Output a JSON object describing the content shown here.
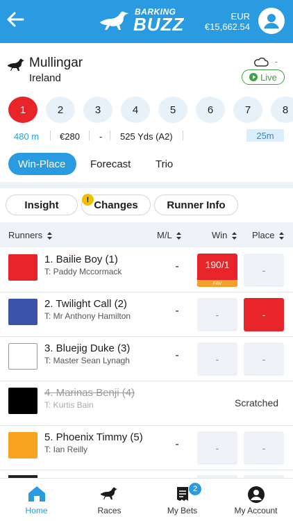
{
  "header": {
    "brand_top": "BARKING",
    "brand_bottom": "BUZZ",
    "currency": "EUR",
    "balance": "€15,662.54"
  },
  "meeting": {
    "track": "Mullingar",
    "country": "Ireland",
    "weather_text": "-",
    "live_label": "Live"
  },
  "races": [
    "1",
    "2",
    "3",
    "4",
    "5",
    "6",
    "7",
    "8"
  ],
  "race_info": {
    "distance": "480 m",
    "prize": "€280",
    "dash": "-",
    "yards": "525 Yds (A2)",
    "countdown": "25m"
  },
  "bet_tabs": [
    "Win-Place",
    "Forecast",
    "Trio"
  ],
  "filters": {
    "insight": "Insight",
    "changes": "Changes",
    "alert": "!",
    "runner_info": "Runner Info"
  },
  "table_headers": {
    "runners": "Runners",
    "ml": "M/L",
    "win": "Win",
    "place": "Place"
  },
  "runners": [
    {
      "name": "1. Bailie Boy (1)",
      "trainer": "T: Paddy Mccormack",
      "ml": "-",
      "win": "190/1",
      "win_tag": "FAV",
      "place": "-",
      "color": "#e8242b"
    },
    {
      "name": "2. Twilight Call (2)",
      "trainer": "T: Mr Anthony Hamilton",
      "ml": "-",
      "win": "-",
      "place": "-",
      "color": "#3a52a8"
    },
    {
      "name": "3. Bluejig Duke (3)",
      "trainer": "T: Master Sean Lynagh",
      "ml": "-",
      "win": "-",
      "place": "-",
      "color": "#ffffff"
    },
    {
      "name": "4. Marinas Benji (4)",
      "trainer": "T: Kurtis Bain",
      "status": "Scratched",
      "color": "#000000"
    },
    {
      "name": "5. Phoenix Timmy (5)",
      "trainer": "T: Ian Reilly",
      "ml": "-",
      "win": "-",
      "place": "-",
      "color": "#f7a31f"
    }
  ],
  "nav": {
    "home": "Home",
    "races": "Races",
    "my_bets": "My Bets",
    "bets_count": "2",
    "account": "My Account"
  },
  "colors": {
    "primary": "#2a9be0",
    "selected_red": "#e8242b",
    "live_green": "#3aa33f",
    "fav_orange": "#f3a12a"
  }
}
